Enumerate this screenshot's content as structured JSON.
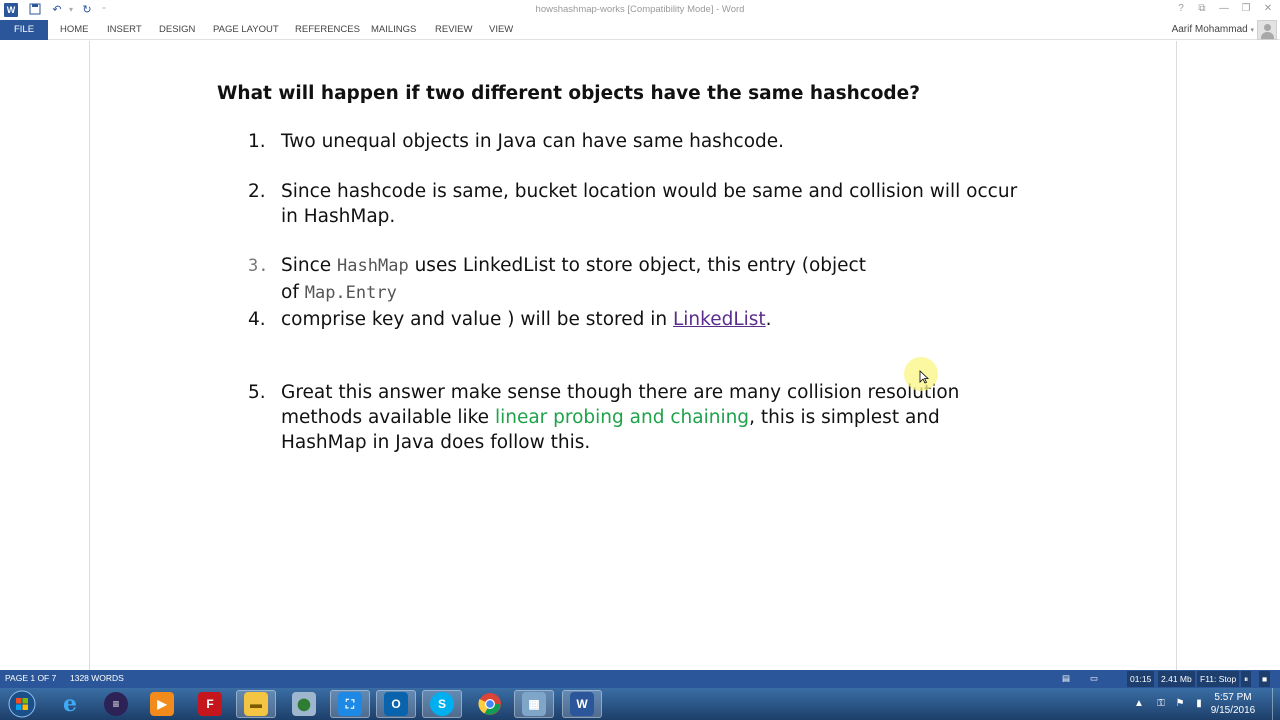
{
  "window": {
    "title": "howshashmap-works [Compatibility Mode] - Word",
    "help": "?",
    "minimize": "—",
    "restore": "❐",
    "close": "✕"
  },
  "ribbon": {
    "tabs": [
      "FILE",
      "HOME",
      "INSERT",
      "DESIGN",
      "PAGE LAYOUT",
      "REFERENCES",
      "MAILINGS",
      "REVIEW",
      "VIEW"
    ],
    "user": "Aarif Mohammad"
  },
  "document": {
    "heading": "What will happen if two different objects have the same hashcode?",
    "items": [
      {
        "num": "1.",
        "lines": [
          "Two unequal objects in Java can have same hashcode."
        ]
      },
      {
        "num": "2.",
        "lines": [
          "Since hashcode is same, bucket location would be same and collision will occur",
          "in HashMap."
        ]
      },
      {
        "num": "3.",
        "line1_pre": "Since ",
        "line1_code": "HashMap",
        "line1_post": "  uses LinkedList to store object, this entry (object",
        "line2_pre": "of ",
        "line2_code": "Map.Entry"
      },
      {
        "num": "4.",
        "pre": "comprise key and value )   will be stored in ",
        "link": "LinkedList",
        "post": "."
      },
      {
        "num": "5.",
        "line1": "Great this answer make sense though there are many collision resolution",
        "line2_pre": "methods available  like ",
        "line2_green": "linear probing and chaining",
        "line2_post": ", this is simplest and",
        "line3": "HashMap in Java does follow this."
      }
    ]
  },
  "status": {
    "page": "PAGE 1 OF 7",
    "words": "1328 WORDS",
    "timer": "01:15",
    "size": "2.41 Mb",
    "hotkey": "F11: Stop"
  },
  "taskbar": {
    "apps": [
      "start-button",
      "internet-explorer",
      "eclipse",
      "media-player",
      "filezilla",
      "file-explorer",
      "file-manager",
      "snipping-tool",
      "outlook",
      "skype",
      "chrome",
      "remote-desktop",
      "word"
    ],
    "time": "5:57 PM",
    "date": "9/15/2016"
  },
  "colors": {
    "accent": "#2b579a",
    "link": "#5a2d8c",
    "highlight": "#1ea24a"
  }
}
